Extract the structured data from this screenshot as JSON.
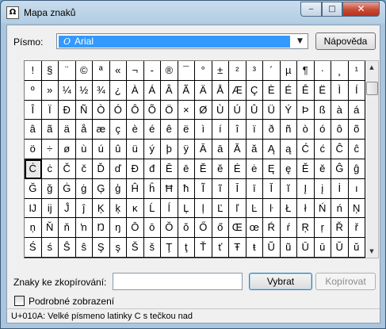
{
  "window": {
    "title": "Mapa znaků",
    "app_icon": "charmap-icon",
    "minimize_glyph": "‒",
    "maximize_glyph": "□",
    "close_glyph": "✕"
  },
  "font_row": {
    "label": "Písmo:",
    "selected_font": "Arial",
    "font_icon": "opentype-font-icon",
    "dropdown_glyph": "▼",
    "help_button": "Nápověda"
  },
  "grid": {
    "selected_row": 5,
    "selected_col": 0,
    "rows": [
      [
        "!",
        "§",
        "¨",
        "©",
        "ª",
        "«",
        "¬",
        "-",
        "®",
        "¯",
        "°",
        "±",
        "²",
        "³",
        "´",
        "µ",
        "¶",
        "·",
        "¸",
        "¹"
      ],
      [
        "º",
        "»",
        "¼",
        "½",
        "¾",
        "¿",
        "À",
        "Á",
        "Â",
        "Ã",
        "Ä",
        "Å",
        "Æ",
        "Ç",
        "È",
        "É",
        "Ê",
        "Ë",
        "Ì",
        "Í"
      ],
      [
        "Î",
        "Ï",
        "Ð",
        "Ñ",
        "Ò",
        "Ó",
        "Ô",
        "Õ",
        "Ö",
        "×",
        "Ø",
        "Ù",
        "Ú",
        "Û",
        "Ü",
        "Ý",
        "Þ",
        "ß",
        "à",
        "á"
      ],
      [
        "â",
        "ã",
        "ä",
        "å",
        "æ",
        "ç",
        "è",
        "é",
        "ê",
        "ë",
        "ì",
        "í",
        "î",
        "ï",
        "ð",
        "ñ",
        "ò",
        "ó",
        "ô",
        "õ"
      ],
      [
        "ö",
        "÷",
        "ø",
        "ù",
        "ú",
        "û",
        "ü",
        "ý",
        "þ",
        "ÿ",
        "Ā",
        "ā",
        "Ă",
        "ă",
        "Ą",
        "ą",
        "Ć",
        "ć",
        "Ĉ",
        "ĉ"
      ],
      [
        "Ċ",
        "ċ",
        "Č",
        "č",
        "Ď",
        "ď",
        "Đ",
        "đ",
        "Ē",
        "ē",
        "Ĕ",
        "ĕ",
        "Ė",
        "ė",
        "Ę",
        "ę",
        "Ě",
        "ě",
        "Ĝ",
        "ĝ"
      ],
      [
        "Ğ",
        "ğ",
        "Ġ",
        "ġ",
        "Ģ",
        "ģ",
        "Ĥ",
        "ĥ",
        "Ħ",
        "ħ",
        "Ĩ",
        "ĩ",
        "Ī",
        "ī",
        "Ĭ",
        "ĭ",
        "Į",
        "į",
        "İ",
        "ı"
      ],
      [
        "Ĳ",
        "ĳ",
        "Ĵ",
        "ĵ",
        "Ķ",
        "ķ",
        "ĸ",
        "Ĺ",
        "ĺ",
        "Ļ",
        "ļ",
        "Ľ",
        "ľ",
        "Ŀ",
        "ŀ",
        "Ł",
        "ł",
        "Ń",
        "ń",
        "Ņ"
      ],
      [
        "ņ",
        "Ň",
        "ň",
        "ŉ",
        "Ŋ",
        "ŋ",
        "Ō",
        "ō",
        "Ŏ",
        "ŏ",
        "Ő",
        "ő",
        "Œ",
        "œ",
        "Ŕ",
        "ŕ",
        "Ŗ",
        "ŗ",
        "Ř",
        "ř"
      ],
      [
        "Ś",
        "ś",
        "Ŝ",
        "ŝ",
        "Ş",
        "ş",
        "Š",
        "š",
        "Ţ",
        "ţ",
        "Ť",
        "ť",
        "Ŧ",
        "ŧ",
        "Ũ",
        "ũ",
        "Ū",
        "ū",
        "Ŭ",
        "ŭ"
      ]
    ]
  },
  "scrollbar": {
    "up_glyph": "▲",
    "down_glyph": "▼",
    "thumb_position_fraction": 0.05
  },
  "copy_row": {
    "label": "Znaky ke zkopírování:",
    "value": "",
    "select_button": "Vybrat",
    "copy_button": "Kopírovat",
    "copy_enabled": false
  },
  "advanced": {
    "label": "Podrobné zobrazení",
    "checked": false
  },
  "status": {
    "text": "U+010A: Velké písmeno latinky C s tečkou nad"
  }
}
